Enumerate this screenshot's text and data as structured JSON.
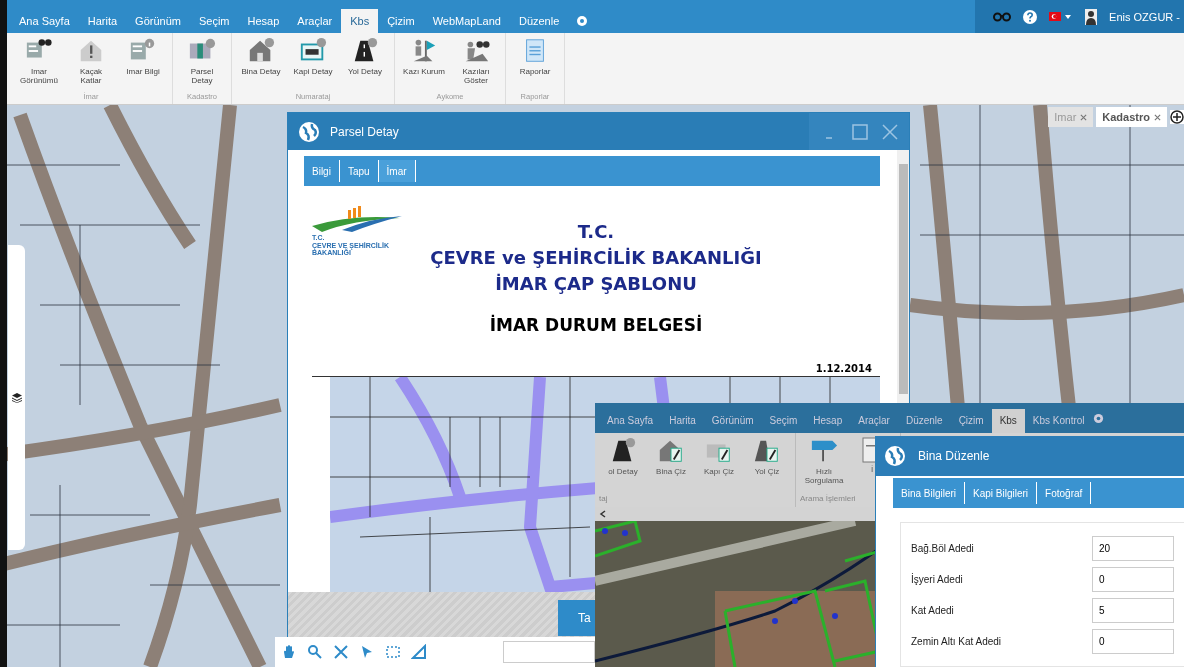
{
  "menu_bar": {
    "tabs": [
      {
        "label": "Ana Sayfa",
        "selected": false
      },
      {
        "label": "Harita",
        "selected": false
      },
      {
        "label": "Görünüm",
        "selected": false
      },
      {
        "label": "Seçim",
        "selected": false
      },
      {
        "label": "Hesap",
        "selected": false
      },
      {
        "label": "Araçlar",
        "selected": false
      },
      {
        "label": "Kbs",
        "selected": true
      },
      {
        "label": "Çizim",
        "selected": false
      },
      {
        "label": "WebMapLand",
        "selected": false
      },
      {
        "label": "Düzenle",
        "selected": false
      }
    ],
    "user_name": "Enis OZGUR -"
  },
  "ribbon": {
    "groups": [
      {
        "label": "İmar",
        "buttons": [
          "Imar\nGörünümü",
          "Kaçak\nKatlar",
          "Imar Bilgi"
        ]
      },
      {
        "label": "Kadastro",
        "buttons": [
          "Parsel\nDetay"
        ]
      },
      {
        "label": "Numarataj",
        "buttons": [
          "Bina Detay",
          "Kapi Detay",
          "Yol Detay"
        ]
      },
      {
        "label": "Aykome",
        "buttons": [
          "Kazı Kurum",
          "Kazıları\nGöster"
        ]
      },
      {
        "label": "Raporlar",
        "buttons": [
          "Raporlar"
        ]
      }
    ]
  },
  "map_tabs": [
    {
      "label": "Imar",
      "selected": false
    },
    {
      "label": "Kadastro",
      "selected": true
    }
  ],
  "parsel_window": {
    "title": "Parsel Detay",
    "tabs": [
      {
        "label": "Bilgi",
        "selected": false
      },
      {
        "label": "Tapu",
        "selected": false
      },
      {
        "label": "İmar",
        "selected": true
      }
    ],
    "document": {
      "logo_text": "T.C.\nÇEVRE VE ŞEHİRCİLİK\nBAKANLIĞI",
      "headings": [
        "T.C.",
        "ÇEVRE ve ŞEHİRCİLİK BAKANLIĞI",
        "İMAR ÇAP ŞABLONU"
      ],
      "title": "İMAR DURUM BELGESİ",
      "date": "1.12.2014"
    },
    "footer_button": "Ta"
  },
  "inner_app": {
    "menu_tabs": [
      {
        "label": "Ana Sayfa",
        "selected": false
      },
      {
        "label": "Harita",
        "selected": false
      },
      {
        "label": "Görünüm",
        "selected": false
      },
      {
        "label": "Seçim",
        "selected": false
      },
      {
        "label": "Hesap",
        "selected": false
      },
      {
        "label": "Araçlar",
        "selected": false
      },
      {
        "label": "Düzenle",
        "selected": false
      },
      {
        "label": "Çizim",
        "selected": false
      },
      {
        "label": "Kbs",
        "selected": true
      },
      {
        "label": "Kbs Kontrol",
        "selected": false
      }
    ],
    "ribbon_groups": [
      {
        "label": "taj",
        "buttons": [
          "ol Detay",
          "Bina Çiz",
          "Kapı Çiz",
          "Yol Çiz"
        ]
      },
      {
        "label": "Arama İşlemleri",
        "buttons": [
          "Hızlı\nSorgulama",
          "İ"
        ]
      }
    ],
    "bina_window": {
      "title": "Bina Düzenle",
      "tabs": [
        {
          "label": "Bina Bilgileri",
          "selected": false
        },
        {
          "label": "Kapi Bilgileri",
          "selected": false
        },
        {
          "label": "Fotoğraf",
          "selected": false
        }
      ],
      "fields": [
        {
          "label": "Bağ.Böl Adedi",
          "value": "20"
        },
        {
          "label": "İşyeri Adedi",
          "value": "0"
        },
        {
          "label": "Kat Adedi",
          "value": "5"
        },
        {
          "label": "Zemin Altı Kat Adedi",
          "value": "0"
        }
      ]
    }
  }
}
